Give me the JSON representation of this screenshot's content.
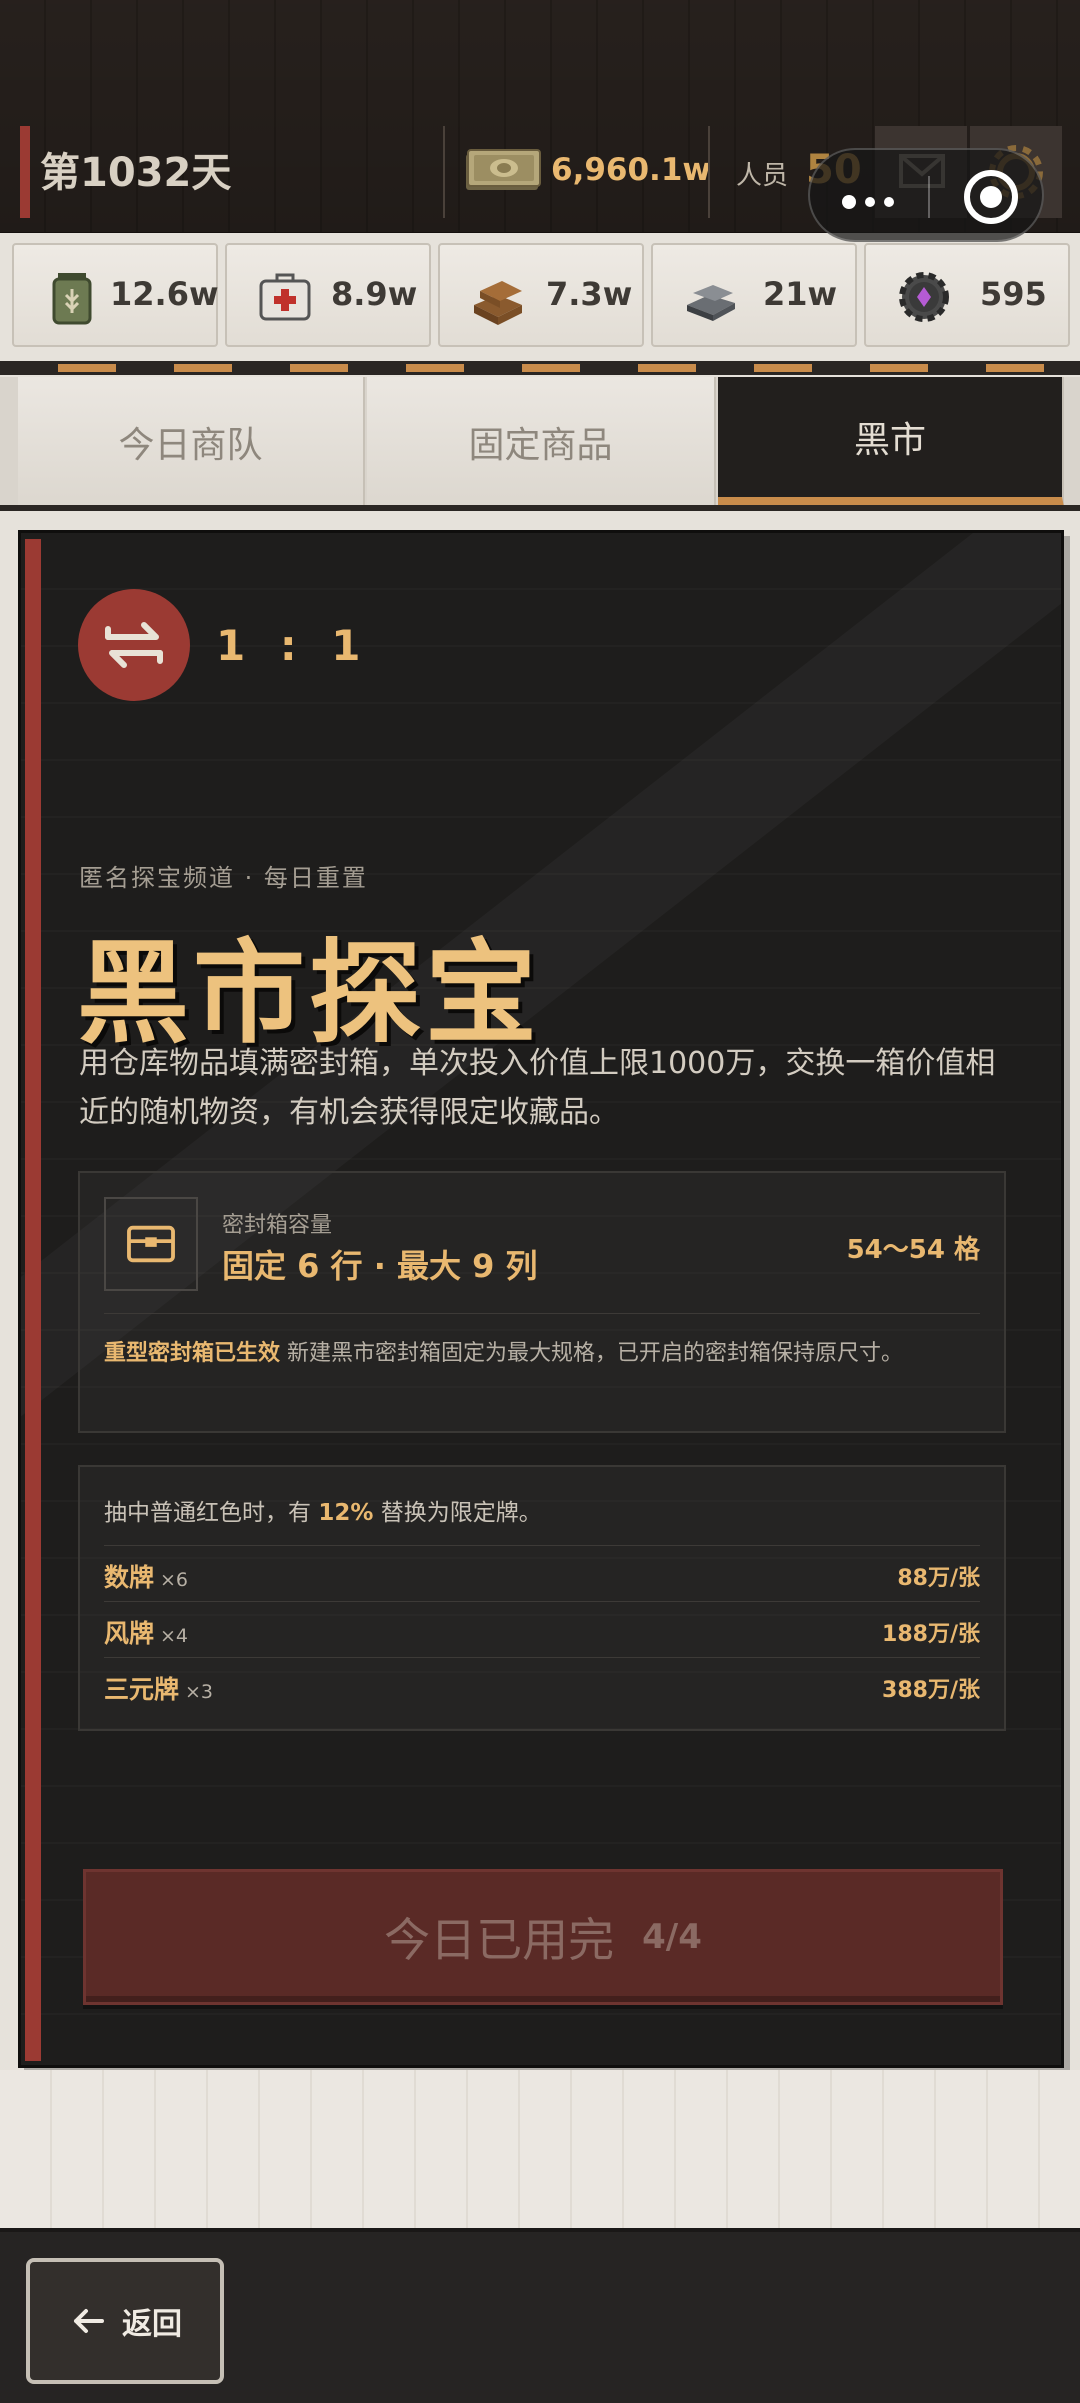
{
  "header": {
    "day": "第1032天",
    "money": "6,960.1w",
    "staff_label": "人员",
    "staff_value": "50"
  },
  "resources": [
    {
      "name": "grain",
      "value": "12.6w"
    },
    {
      "name": "medkit",
      "value": "8.9w"
    },
    {
      "name": "wood",
      "value": "7.3w"
    },
    {
      "name": "steel",
      "value": "21w"
    },
    {
      "name": "parts",
      "value": "595"
    }
  ],
  "tabs": [
    {
      "label": "今日商队",
      "active": false
    },
    {
      "label": "固定商品",
      "active": false
    },
    {
      "label": "黑市",
      "active": true
    }
  ],
  "market": {
    "ratio": "1 : 1",
    "kicker": "匿名探宝频道 · 每日重置",
    "title": "黑市探宝",
    "description": "用仓库物品填满密封箱，单次投入价值上限1000万，交换一箱价值相近的随机物资，有机会获得限定收藏品。",
    "capacity_label": "密封箱容量",
    "capacity_value": "固定 6 行 · 最大 9 列",
    "capacity_count": "54～54 格",
    "note_highlight": "重型密封箱已生效",
    "note_text": "新建黑市密封箱固定为最大规格，已开启的密封箱保持原尺寸。",
    "promo_prefix": "抽中普通红色时，有",
    "promo_pct": "12%",
    "promo_suffix": "替换为限定牌。",
    "tiles": [
      {
        "name": "数牌",
        "count": "×6",
        "price": "88万/张"
      },
      {
        "name": "风牌",
        "count": "×4",
        "price": "188万/张"
      },
      {
        "name": "三元牌",
        "count": "×3",
        "price": "388万/张"
      }
    ],
    "action_label": "今日已用完",
    "action_count": "4/4"
  },
  "footer": {
    "back_label": "返回"
  },
  "colors": {
    "accent_red": "#9b3a33",
    "gold": "#e9b870",
    "dark_panel": "#1e1d1c",
    "stripe_orange": "#c98c4b"
  }
}
